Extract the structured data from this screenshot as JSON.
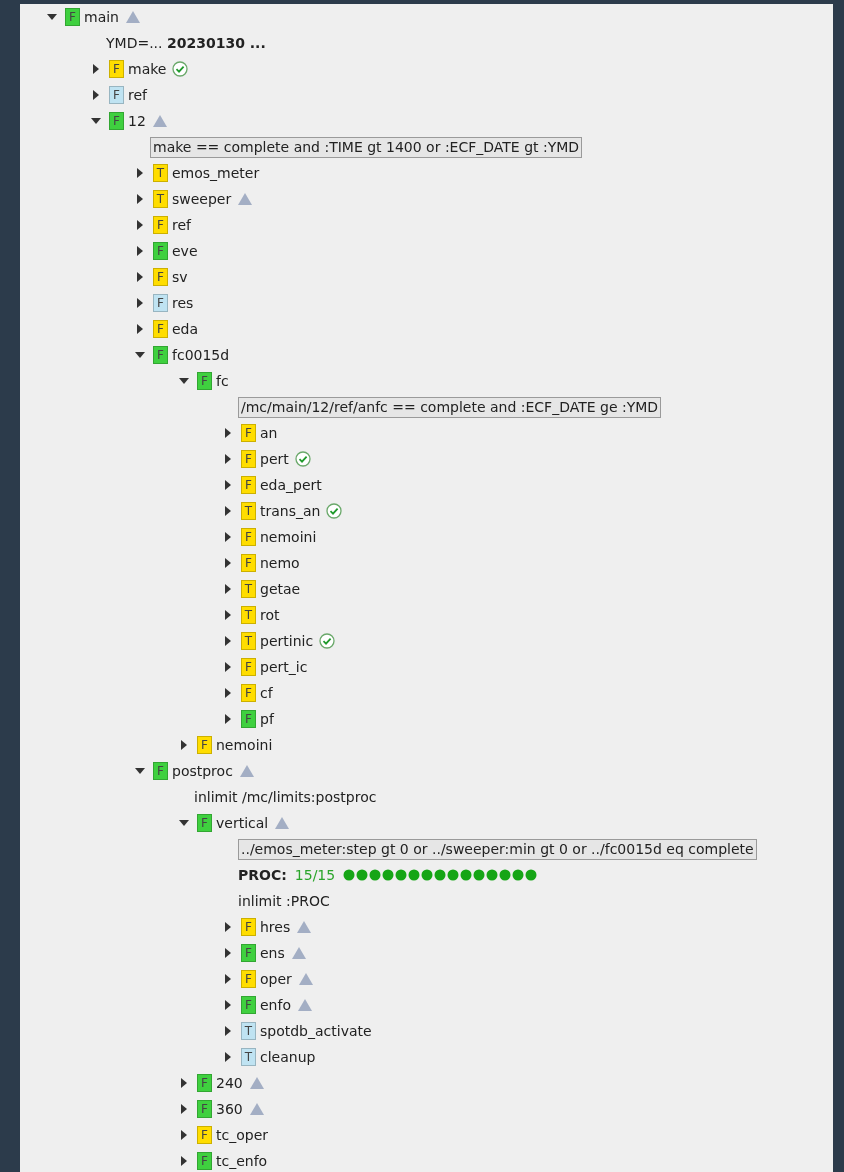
{
  "tree": [
    {
      "kind": "node",
      "type": "F",
      "name": "main",
      "color": "#3fd03f",
      "expanded": true,
      "waiting": true,
      "complete": false,
      "children": [
        {
          "kind": "info",
          "text": "YMD=... **20230130 ...**"
        },
        {
          "kind": "node",
          "type": "F",
          "name": "make",
          "color": "#ffdd00",
          "expanded": false,
          "waiting": false,
          "complete": true
        },
        {
          "kind": "node",
          "type": "F",
          "name": "ref",
          "color": "#bfe3f2",
          "expanded": false,
          "waiting": false,
          "complete": false
        },
        {
          "kind": "node",
          "type": "F",
          "name": "12",
          "color": "#3fd03f",
          "expanded": true,
          "waiting": true,
          "complete": false,
          "children": [
            {
              "kind": "trigger",
              "text": "make == complete and :TIME gt 1400 or :ECF_DATE gt :YMD"
            },
            {
              "kind": "node",
              "type": "T",
              "name": "emos_meter",
              "color": "#ffdd00",
              "expanded": false,
              "waiting": false,
              "complete": false
            },
            {
              "kind": "node",
              "type": "T",
              "name": "sweeper",
              "color": "#ffdd00",
              "expanded": false,
              "waiting": true,
              "complete": false
            },
            {
              "kind": "node",
              "type": "F",
              "name": "ref",
              "color": "#ffdd00",
              "expanded": false,
              "waiting": false,
              "complete": false
            },
            {
              "kind": "node",
              "type": "F",
              "name": "eve",
              "color": "#3fd03f",
              "expanded": false,
              "waiting": false,
              "complete": false
            },
            {
              "kind": "node",
              "type": "F",
              "name": "sv",
              "color": "#ffdd00",
              "expanded": false,
              "waiting": false,
              "complete": false
            },
            {
              "kind": "node",
              "type": "F",
              "name": "res",
              "color": "#bfe3f2",
              "expanded": false,
              "waiting": false,
              "complete": false
            },
            {
              "kind": "node",
              "type": "F",
              "name": "eda",
              "color": "#ffdd00",
              "expanded": false,
              "waiting": false,
              "complete": false
            },
            {
              "kind": "node",
              "type": "F",
              "name": "fc0015d",
              "color": "#3fd03f",
              "expanded": true,
              "waiting": false,
              "complete": false,
              "children": [
                {
                  "kind": "node",
                  "type": "F",
                  "name": "fc",
                  "color": "#3fd03f",
                  "expanded": true,
                  "waiting": false,
                  "complete": false,
                  "children": [
                    {
                      "kind": "trigger",
                      "text": "/mc/main/12/ref/anfc == complete and :ECF_DATE ge :YMD"
                    },
                    {
                      "kind": "node",
                      "type": "F",
                      "name": "an",
                      "color": "#ffdd00",
                      "expanded": false,
                      "waiting": false,
                      "complete": false
                    },
                    {
                      "kind": "node",
                      "type": "F",
                      "name": "pert",
                      "color": "#ffdd00",
                      "expanded": false,
                      "waiting": false,
                      "complete": true
                    },
                    {
                      "kind": "node",
                      "type": "F",
                      "name": "eda_pert",
                      "color": "#ffdd00",
                      "expanded": false,
                      "waiting": false,
                      "complete": false
                    },
                    {
                      "kind": "node",
                      "type": "T",
                      "name": "trans_an",
                      "color": "#ffdd00",
                      "expanded": false,
                      "waiting": false,
                      "complete": true
                    },
                    {
                      "kind": "node",
                      "type": "F",
                      "name": "nemoini",
                      "color": "#ffdd00",
                      "expanded": false,
                      "waiting": false,
                      "complete": false
                    },
                    {
                      "kind": "node",
                      "type": "F",
                      "name": "nemo",
                      "color": "#ffdd00",
                      "expanded": false,
                      "waiting": false,
                      "complete": false
                    },
                    {
                      "kind": "node",
                      "type": "T",
                      "name": "getae",
                      "color": "#ffdd00",
                      "expanded": false,
                      "waiting": false,
                      "complete": false
                    },
                    {
                      "kind": "node",
                      "type": "T",
                      "name": "rot",
                      "color": "#ffdd00",
                      "expanded": false,
                      "waiting": false,
                      "complete": false
                    },
                    {
                      "kind": "node",
                      "type": "T",
                      "name": "pertinic",
                      "color": "#ffdd00",
                      "expanded": false,
                      "waiting": false,
                      "complete": true
                    },
                    {
                      "kind": "node",
                      "type": "F",
                      "name": "pert_ic",
                      "color": "#ffdd00",
                      "expanded": false,
                      "waiting": false,
                      "complete": false
                    },
                    {
                      "kind": "node",
                      "type": "F",
                      "name": "cf",
                      "color": "#ffdd00",
                      "expanded": false,
                      "waiting": false,
                      "complete": false
                    },
                    {
                      "kind": "node",
                      "type": "F",
                      "name": "pf",
                      "color": "#3fd03f",
                      "expanded": false,
                      "waiting": false,
                      "complete": false
                    }
                  ]
                },
                {
                  "kind": "node",
                  "type": "F",
                  "name": "nemoini",
                  "color": "#ffdd00",
                  "expanded": false,
                  "waiting": false,
                  "complete": false
                }
              ]
            },
            {
              "kind": "node",
              "type": "F",
              "name": "postproc",
              "color": "#3fd03f",
              "expanded": true,
              "waiting": true,
              "complete": false,
              "children": [
                {
                  "kind": "info",
                  "text": "inlimit /mc/limits:postproc"
                },
                {
                  "kind": "node",
                  "type": "F",
                  "name": "vertical",
                  "color": "#3fd03f",
                  "expanded": true,
                  "waiting": true,
                  "complete": false,
                  "children": [
                    {
                      "kind": "trigger",
                      "text": "../emos_meter:step gt 0 or ../sweeper:min gt 0 or ../fc0015d eq complete"
                    },
                    {
                      "kind": "limit",
                      "label": "PROC:",
                      "reading": "15/15"
                    },
                    {
                      "kind": "info",
                      "text": "inlimit :PROC"
                    },
                    {
                      "kind": "node",
                      "type": "F",
                      "name": "hres",
                      "color": "#ffdd00",
                      "expanded": false,
                      "waiting": true,
                      "complete": false
                    },
                    {
                      "kind": "node",
                      "type": "F",
                      "name": "ens",
                      "color": "#3fd03f",
                      "expanded": false,
                      "waiting": true,
                      "complete": false
                    },
                    {
                      "kind": "node",
                      "type": "F",
                      "name": "oper",
                      "color": "#ffdd00",
                      "expanded": false,
                      "waiting": true,
                      "complete": false
                    },
                    {
                      "kind": "node",
                      "type": "F",
                      "name": "enfo",
                      "color": "#3fd03f",
                      "expanded": false,
                      "waiting": true,
                      "complete": false
                    },
                    {
                      "kind": "node",
                      "type": "T",
                      "name": "spotdb_activate",
                      "color": "#bfe3f2",
                      "expanded": false,
                      "waiting": false,
                      "complete": false
                    },
                    {
                      "kind": "node",
                      "type": "T",
                      "name": "cleanup",
                      "color": "#bfe3f2",
                      "expanded": false,
                      "waiting": false,
                      "complete": false
                    }
                  ]
                },
                {
                  "kind": "node",
                  "type": "F",
                  "name": "240",
                  "color": "#3fd03f",
                  "expanded": false,
                  "waiting": true,
                  "complete": false
                },
                {
                  "kind": "node",
                  "type": "F",
                  "name": "360",
                  "color": "#3fd03f",
                  "expanded": false,
                  "waiting": true,
                  "complete": false
                },
                {
                  "kind": "node",
                  "type": "F",
                  "name": "tc_oper",
                  "color": "#ffdd00",
                  "expanded": false,
                  "waiting": false,
                  "complete": false
                },
                {
                  "kind": "node",
                  "type": "F",
                  "name": "tc_enfo",
                  "color": "#3fd03f",
                  "expanded": false,
                  "waiting": false,
                  "complete": false
                }
              ]
            }
          ]
        }
      ]
    }
  ]
}
